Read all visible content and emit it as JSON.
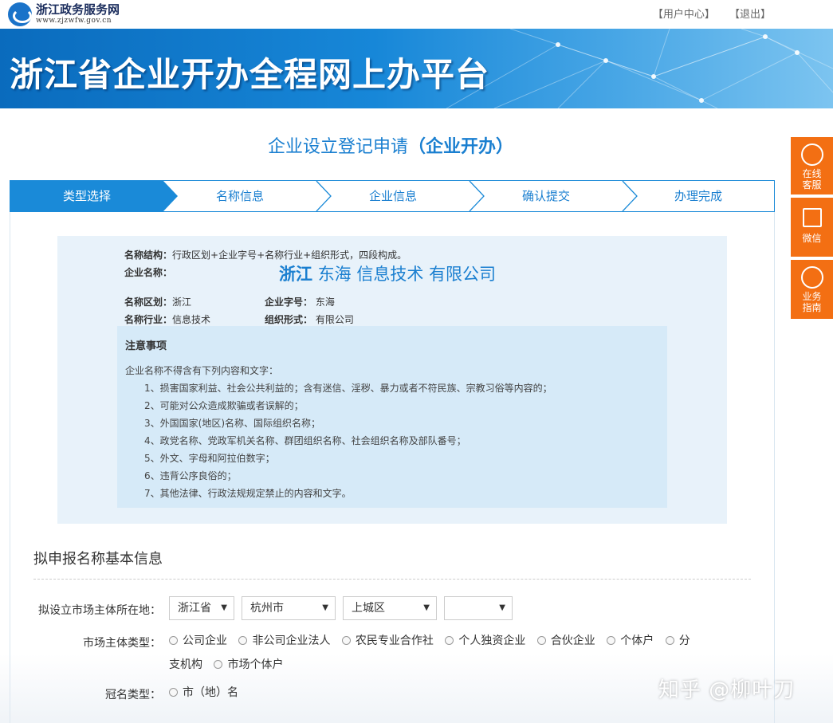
{
  "header": {
    "logo_title": "浙江政务服务网",
    "logo_url": "www.zjzwfw.gov.cn",
    "links": [
      "【用户中心】",
      "【退出】"
    ]
  },
  "banner": {
    "title": "浙江省企业开办全程网上办平台"
  },
  "page": {
    "title_prefix": "企业设立登记申请",
    "title_bold": "（企业开办）"
  },
  "steps": [
    "类型选择",
    "名称信息",
    "企业信息",
    "确认提交",
    "办理完成"
  ],
  "name_info": {
    "structure_label": "名称结构：",
    "structure_value": "行政区划+企业字号+名称行业+组织形式，四段构成。",
    "name_label": "企业名称：",
    "name_parts": [
      "浙江",
      "东海",
      "信息技术",
      "有限公司"
    ],
    "region_label": "名称区划：",
    "region_value": "浙江",
    "trade_label": "企业字号：",
    "trade_value": "东海",
    "industry_label": "名称行业：",
    "industry_value": "信息技术",
    "form_label": "组织形式：",
    "form_value": "有限公司"
  },
  "notice": {
    "title": "注意事项",
    "intro": "企业名称不得含有下列内容和文字：",
    "items": [
      "1、损害国家利益、社会公共利益的；含有迷信、淫秽、暴力或者不符民族、宗教习俗等内容的；",
      "2、可能对公众造成欺骗或者误解的；",
      "3、外国国家(地区)名称、国际组织名称；",
      "4、政党名称、党政军机关名称、群团组织名称、社会组织名称及部队番号；",
      "5、外文、字母和阿拉伯数字；",
      "6、违背公序良俗的；",
      "7、其他法律、行政法规规定禁止的内容和文字。"
    ]
  },
  "form": {
    "section_title": "拟申报名称基本信息",
    "location_label": "拟设立市场主体所在地：",
    "province": "浙江省",
    "city": "杭州市",
    "district": "上城区",
    "street": "",
    "type_label": "市场主体类型：",
    "types_line1": [
      "公司企业",
      "非公司企业法人",
      "农民专业合作社",
      "个人独资企业",
      "合伙企业",
      "个体户",
      "分"
    ],
    "types_line2_first": "支机构",
    "types_line2": [
      "市场个体户"
    ],
    "crown_label": "冠名类型：",
    "crown_option": "市（地）名"
  },
  "sidebar": {
    "service": [
      "在线",
      "客服"
    ],
    "wechat": "微信",
    "guide": [
      "业务",
      "指南"
    ]
  },
  "watermark": "知乎 @柳叶刀",
  "colors": {
    "brand_blue": "#1a7fd0",
    "orange": "#f36f13",
    "panel": "#e8f2fa"
  }
}
